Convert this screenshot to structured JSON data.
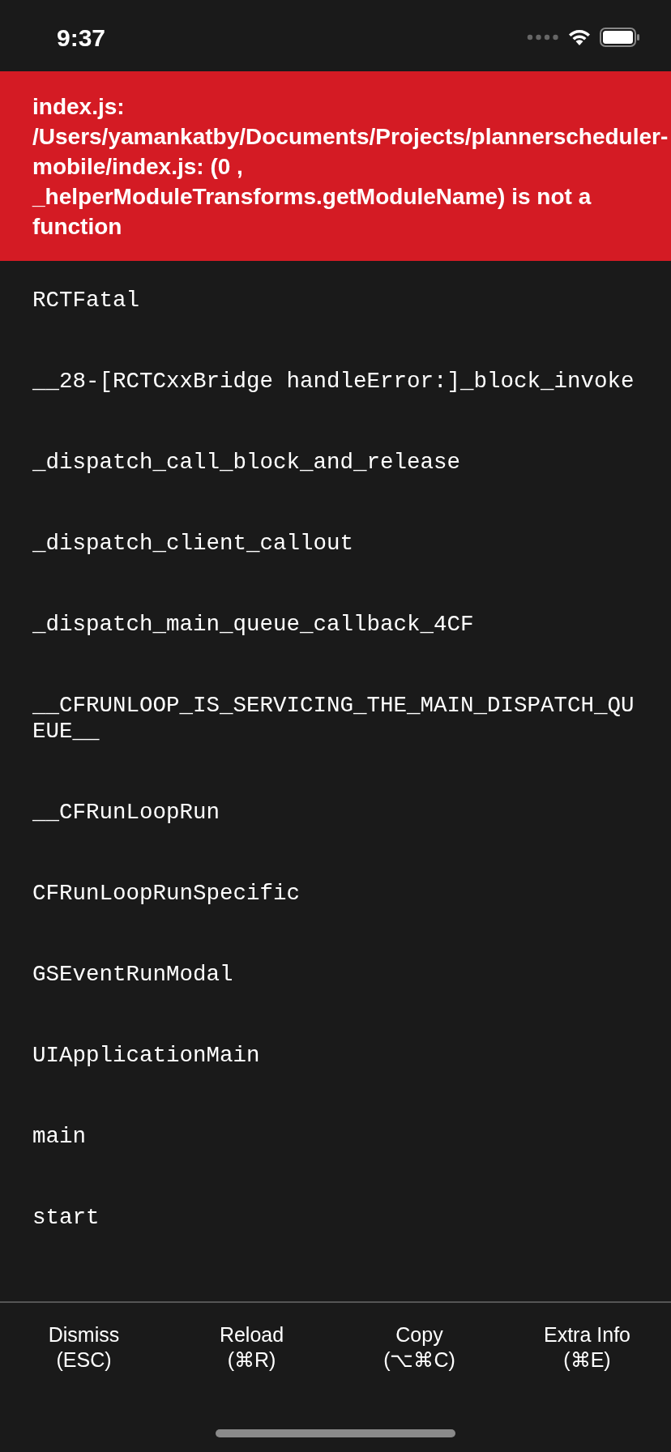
{
  "status_bar": {
    "time": "9:37"
  },
  "error": {
    "message": "index.js: /Users/yamankatby/Documents/Projects/plannerscheduler-mobile/index.js: (0 , _helperModuleTransforms.getModuleName) is not a function"
  },
  "stack_frames": [
    "RCTFatal",
    "__28-[RCTCxxBridge handleError:]_block_invoke",
    "_dispatch_call_block_and_release",
    "_dispatch_client_callout",
    "_dispatch_main_queue_callback_4CF",
    "__CFRUNLOOP_IS_SERVICING_THE_MAIN_DISPATCH_QUEUE__",
    "__CFRunLoopRun",
    "CFRunLoopRunSpecific",
    "GSEventRunModal",
    "UIApplicationMain",
    "main",
    "start"
  ],
  "buttons": [
    {
      "label": "Dismiss",
      "shortcut": "(ESC)"
    },
    {
      "label": "Reload",
      "shortcut": "(⌘R)"
    },
    {
      "label": "Copy",
      "shortcut": "(⌥⌘C)"
    },
    {
      "label": "Extra Info",
      "shortcut": "(⌘E)"
    }
  ]
}
